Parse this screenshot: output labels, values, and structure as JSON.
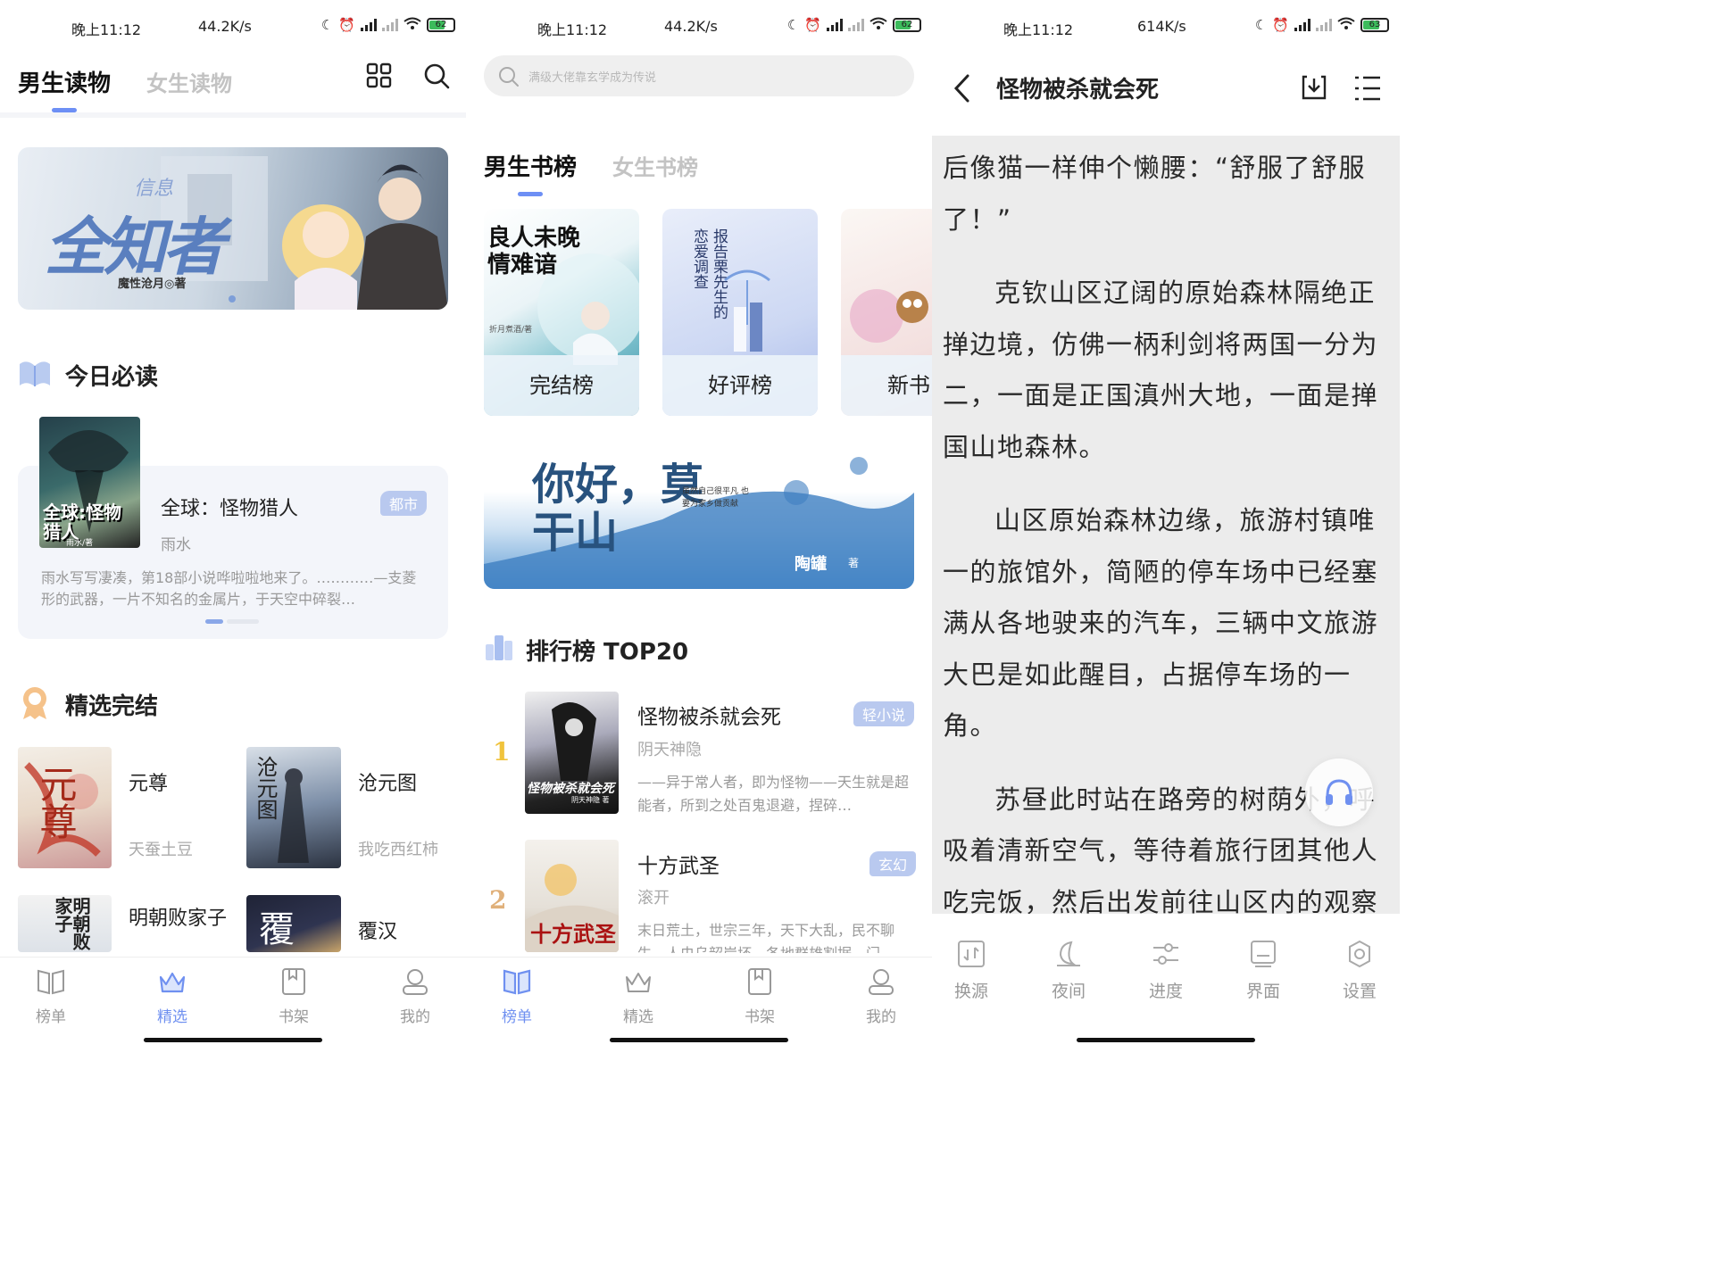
{
  "status_bars": [
    {
      "time": "晚上11:12",
      "speed": "44.2K/s",
      "battery": "62",
      "battery_level": 0.62
    },
    {
      "time": "晚上11:12",
      "speed": "44.2K/s",
      "battery": "62",
      "battery_level": 0.62
    },
    {
      "time": "晚上11:12",
      "speed": "614K/s",
      "battery": "63",
      "battery_level": 0.63
    }
  ],
  "screen1": {
    "tabs": [
      "男生读物",
      "女生读物"
    ],
    "banner": {
      "subtitle": "信息",
      "title": "全知者",
      "author": "魔性沧月◎著"
    },
    "today": {
      "title": "今日必读",
      "book": {
        "title": "全球：怪物猎人",
        "author": "雨水",
        "tag": "都市",
        "desc": "雨水写写凄凑，第18部小说哗啦啦地来了。…………—支菱形的武器，一片不知名的金属片，于天空中碎裂…",
        "cover_text": "全球:怪物猎人",
        "cover_sub": "雨水/著"
      }
    },
    "selected": {
      "title": "精选完结",
      "books": [
        {
          "title": "元尊",
          "author": "天蚕土豆",
          "cover_text": "元尊"
        },
        {
          "title": "沧元图",
          "author": "我吃西红柿",
          "cover_text": "沧元图"
        },
        {
          "title": "明朝败家子",
          "author": "",
          "cover_text": "明朝败家子"
        },
        {
          "title": "覆汉",
          "author": "",
          "cover_text": "覆"
        }
      ]
    },
    "nav": [
      "榜单",
      "精选",
      "书架",
      "我的"
    ],
    "nav_active": 1
  },
  "screen2": {
    "search_placeholder": "满级大佬靠玄学成为传说",
    "tabs": [
      "男生书榜",
      "女生书榜"
    ],
    "rank_cards": [
      {
        "label": "完结榜",
        "cover_title": "良人未晚情难谙",
        "cover_author": "折月煮酒/著"
      },
      {
        "label": "好评榜",
        "cover_title": "报告栗先生的恋爱调查"
      },
      {
        "label": "新书"
      }
    ],
    "banner": {
      "title": "你好，莫干山",
      "quote": "虽然自己很平凡 也要为家乡做贡献",
      "author": "陶罐",
      "author_suffix": "著"
    },
    "top_title": "排行榜 TOP20",
    "top_items": [
      {
        "rank": "1",
        "title": "怪物被杀就会死",
        "author": "阴天神隐",
        "tag": "轻小说",
        "desc": "——异于常人者，即为怪物——天生就是超能者，所到之处百鬼退避，捏碎…",
        "cover_text": "怪物被杀就会死",
        "cover_sub": "阴天神隐 著"
      },
      {
        "rank": "2",
        "title": "十方武圣",
        "author": "滚开",
        "tag": "玄幻",
        "desc": "末日荒土，世宗三年，天下大乱，民不聊生，人虫乌韶岸坏，各地群雄割据，门…",
        "cover_text": "十方武圣"
      }
    ],
    "nav": [
      "榜单",
      "精选",
      "书架",
      "我的"
    ],
    "nav_active": 0
  },
  "screen3": {
    "chapter_title": "怪物被杀就会死",
    "paragraphs": [
      "后像猫一样伸个懒腰：“舒服了舒服了！”",
      "克钦山区辽阔的原始森林隔绝正掸边境，仿佛一柄利剑将两国一分为二，一面是正国滇州大地，一面是掸国山地森林。",
      "山区原始森林边缘，旅游村镇唯一的旅馆外，简陋的停车场中已经塞满从各地驶来的汽车，三辆中文旅游大巴是如此醒目，占据停车场的一角。",
      "苏昼此时站在路旁的树荫外，呼吸着清新空气，等待着旅行团其他人吃完饭，然后出发前往山区内的观察景点。"
    ],
    "toolbar": [
      "换源",
      "夜间",
      "进度",
      "界面",
      "设置"
    ]
  },
  "colors": {
    "accent": "#6f90f0",
    "tag_bg": "#b9c9ef",
    "reader_bg": "#ececec"
  }
}
